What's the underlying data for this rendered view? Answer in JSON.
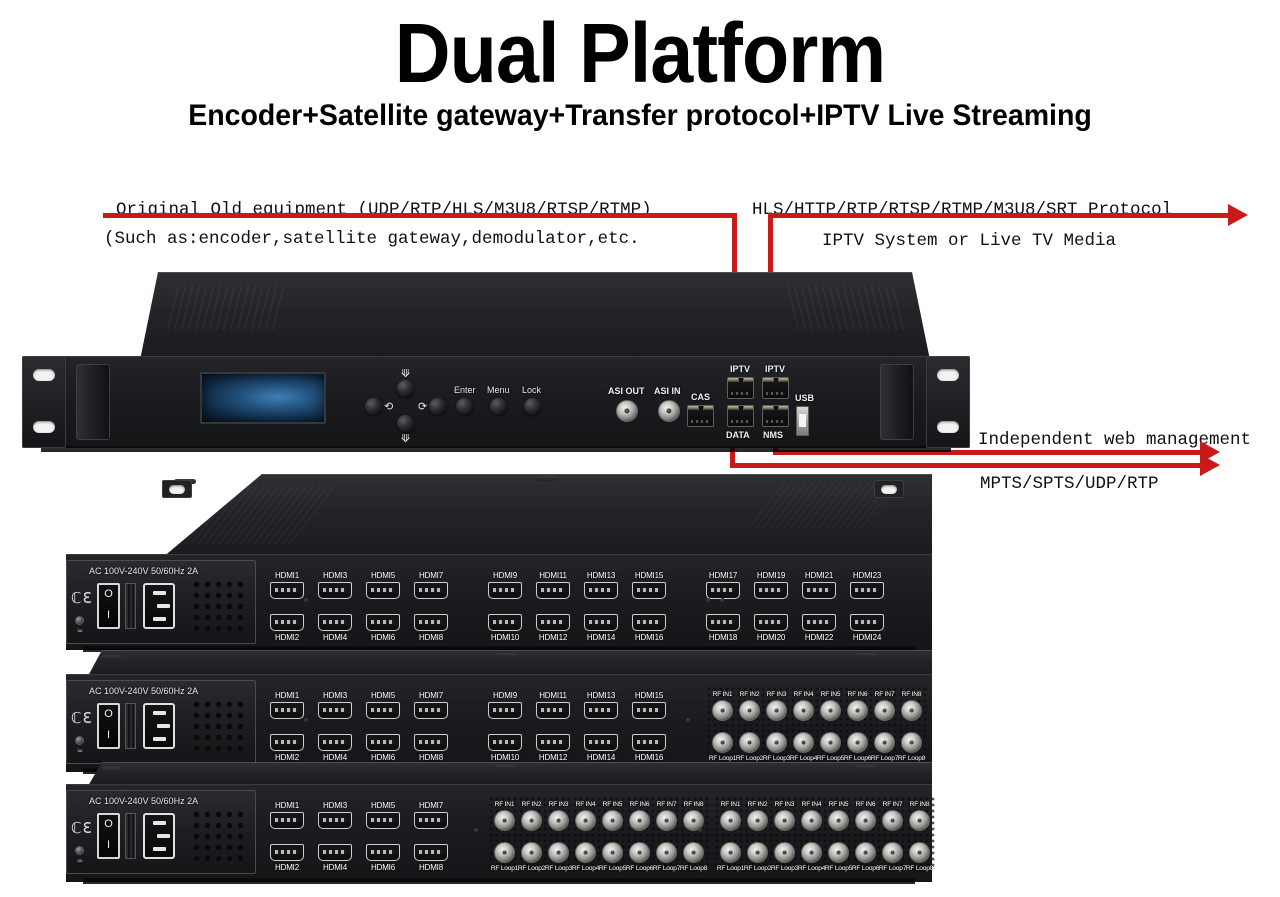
{
  "title": {
    "main": "Dual Platform",
    "sub": "Encoder+Satellite gateway+Transfer protocol+IPTV Live Streaming"
  },
  "annotations": {
    "input_line1": "Original Old equipment (UDP/RTP/HLS/M3U8/RTSP/RTMP)",
    "input_line2": "(Such as:encoder,satellite gateway,demodulator,etc.",
    "output_line1": "HLS/HTTP/RTP/RTSP/RTMP/M3U8/SRT Protocol",
    "output_line2": "IPTV System or Live TV Media",
    "web_management": "Independent web management",
    "stream_output": "MPTS/SPTS/UDP/RTP"
  },
  "colors": {
    "arrow_red": "#c81a1a",
    "chassis_dark": "#1b1c1f",
    "lcd_blue": "#22507c"
  },
  "unit1": {
    "name": "IPTV gateway front panel",
    "buttons": [
      "Enter",
      "Menu",
      "Lock"
    ],
    "dpad": [
      "up",
      "left",
      "right",
      "down"
    ],
    "ports": [
      {
        "label": "ASI OUT",
        "type": "bnc"
      },
      {
        "label": "ASI IN",
        "type": "bnc"
      },
      {
        "label": "CAS",
        "type": "rj45"
      },
      {
        "label": "IPTV",
        "type": "rj45"
      },
      {
        "label": "IPTV",
        "type": "rj45"
      },
      {
        "label": "DATA",
        "type": "rj45"
      },
      {
        "label": "NMS",
        "type": "rj45"
      },
      {
        "label": "USB",
        "type": "usb"
      }
    ]
  },
  "power": {
    "rating": "AC 100V-240V 50/60Hz 2A",
    "ce_mark": "CE",
    "switch_on": "O",
    "switch_off": "I"
  },
  "unit2": {
    "name": "24-channel HDMI encoder",
    "hdmi_top": [
      "HDMI1",
      "HDMI3",
      "HDMI5",
      "HDMI7",
      "HDMI9",
      "HDMI11",
      "HDMI13",
      "HDMI15",
      "HDMI17",
      "HDMI19",
      "HDMI21",
      "HDMI23"
    ],
    "hdmi_bottom": [
      "HDMI2",
      "HDMI4",
      "HDMI6",
      "HDMI8",
      "HDMI10",
      "HDMI12",
      "HDMI14",
      "HDMI16",
      "HDMI18",
      "HDMI20",
      "HDMI22",
      "HDMI24"
    ]
  },
  "unit3": {
    "name": "16-channel HDMI plus 8 RF encoder",
    "hdmi_top": [
      "HDMI1",
      "HDMI3",
      "HDMI5",
      "HDMI7",
      "HDMI9",
      "HDMI11",
      "HDMI13",
      "HDMI15"
    ],
    "hdmi_bottom": [
      "HDMI2",
      "HDMI4",
      "HDMI6",
      "HDMI8",
      "HDMI10",
      "HDMI12",
      "HDMI14",
      "HDMI16"
    ],
    "rf_in": [
      "RF IN1",
      "RF IN2",
      "RF IN3",
      "RF IN4",
      "RF IN5",
      "RF IN6",
      "RF IN7",
      "RF IN8"
    ],
    "rf_loop": [
      "RF Loop1",
      "RF Loop2",
      "RF Loop3",
      "RF Loop4",
      "RF Loop5",
      "RF Loop6",
      "RF Loop7",
      "RF Loop8"
    ]
  },
  "unit4": {
    "name": "8-channel HDMI plus 16 RF encoder",
    "hdmi_top": [
      "HDMI1",
      "HDMI3",
      "HDMI5",
      "HDMI7"
    ],
    "hdmi_bottom": [
      "HDMI2",
      "HDMI4",
      "HDMI6",
      "HDMI8"
    ],
    "rf_in_a": [
      "RF IN1",
      "RF IN2",
      "RF IN3",
      "RF IN4",
      "RF IN5",
      "RF IN6",
      "RF IN7",
      "RF IN8"
    ],
    "rf_loop_a": [
      "RF Loop1",
      "RF Loop2",
      "RF Loop3",
      "RF Loop4",
      "RF Loop5",
      "RF Loop6",
      "RF Loop7",
      "RF Loop8"
    ],
    "rf_in_b": [
      "RF IN1",
      "RF IN2",
      "RF IN3",
      "RF IN4",
      "RF IN5",
      "RF IN6",
      "RF IN7",
      "RF IN8"
    ],
    "rf_loop_b": [
      "RF Loop1",
      "RF Loop2",
      "RF Loop3",
      "RF Loop4",
      "RF Loop5",
      "RF Loop6",
      "RF Loop7",
      "RF Loop8"
    ]
  }
}
